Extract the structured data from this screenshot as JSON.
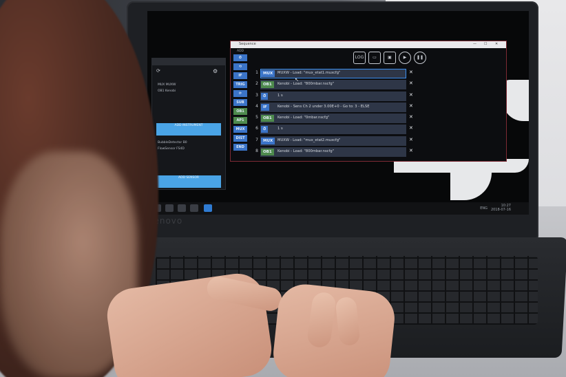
{
  "laptop": {
    "brand": "Lenovo"
  },
  "left_window": {
    "instruments": [
      "MUX MUXW",
      "OB1 Kenobi"
    ],
    "sensors": [
      "BubbleDetector B0",
      "FlowSensor FS4D"
    ],
    "add_instrument_label": "ADD INSTRUMENT",
    "add_sensor_label": "ADD SENSOR"
  },
  "sequence_window": {
    "title": "Sequence",
    "palette_label": "ADD",
    "palette": [
      "⏱",
      "⟲",
      "IF",
      "TRIG",
      "⟳",
      "SUB",
      "OB1",
      "AP1",
      "MUX",
      "DIST",
      "END"
    ],
    "toolbar": [
      "LOG",
      "folder-icon",
      "save-icon",
      "play-icon",
      "pause-icon"
    ],
    "steps": [
      {
        "num": "1",
        "tag": "MUX",
        "tag_color": "blue",
        "text": "MUXW - Load: \"mux_etat1.muxcfg\"",
        "selected": true
      },
      {
        "num": "2",
        "tag": "OB1",
        "tag_color": "green",
        "text": "Kenobi - Load: \"800mbar.nscfg\"",
        "selected": false
      },
      {
        "num": "3",
        "tag": "⏱",
        "tag_color": "blue",
        "text": "1 s",
        "selected": false
      },
      {
        "num": "4",
        "tag": "IF",
        "tag_color": "blue",
        "text": "Kenobi - Sens Ch 2 under 3.00E+0 - Go to: 3 - ELSE",
        "selected": false
      },
      {
        "num": "5",
        "tag": "OB1",
        "tag_color": "green",
        "text": "Kenobi - Load: \"0mbar.nscfg\"",
        "selected": false
      },
      {
        "num": "6",
        "tag": "⏱",
        "tag_color": "blue",
        "text": "1 s",
        "selected": false
      },
      {
        "num": "7",
        "tag": "MUX",
        "tag_color": "blue",
        "text": "MUXW - Load: \"mux_etat2.muxcfg\"",
        "selected": false
      },
      {
        "num": "8",
        "tag": "OB1",
        "tag_color": "green",
        "text": "Kenobi - Load: \"800mbar.nscfg\"",
        "selected": false
      }
    ],
    "delete_glyph": "✕"
  },
  "taskbar": {
    "time": "10:27",
    "date": "2018-07-16",
    "lang": "ENG"
  }
}
